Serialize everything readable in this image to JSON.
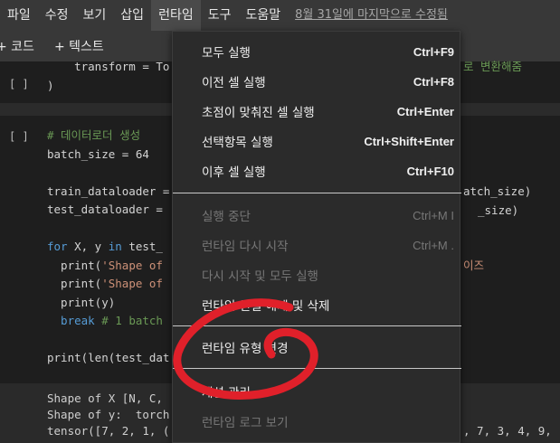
{
  "menubar": {
    "items": [
      "파일",
      "수정",
      "보기",
      "삽입",
      "런타임",
      "도구",
      "도움말"
    ],
    "last_edit": "8월 31일에 마지막으로 수정됨"
  },
  "toolbar": {
    "code": "+ 코드",
    "text": "+ 텍스트"
  },
  "cells": {
    "cell1": {
      "bracket": "[ ]",
      "line_a": "    transform = To",
      "line_a_tail": "로 변환해줌",
      "line_b": ")"
    },
    "cell2": {
      "bracket": "[ ]",
      "comment": "# 데이터로더 생성",
      "batch": "batch_size = 64",
      "train": "train_dataloader = ",
      "train_tail": "atch_size)",
      "test": "test_dataloader = ",
      "test_tail": "_size)",
      "for_kw": "for",
      "for_rest": " X, y ",
      "in_kw": "in",
      "for_rest2": " test_",
      "print1_fn": "  print(",
      "print1_str": "'Shape of ",
      "print1_tail": "이즈",
      "print2_fn": "  print(",
      "print2_str": "'Shape of ",
      "print3": "  print(y)",
      "break_kw": "  break",
      "break_cm": " # 1 batch",
      "print_len": "print(len(test_dat"
    }
  },
  "output": {
    "line1": "Shape of X [N, C, ",
    "line2": "Shape of y:  torch",
    "line3": "tensor([7, 2, 1, (",
    "line3_tail": ", 7, 3, 4, 9,"
  },
  "dropdown": {
    "items": [
      {
        "label": "모두 실행",
        "shortcut": "Ctrl+F9",
        "enabled": true
      },
      {
        "label": "이전 셀 실행",
        "shortcut": "Ctrl+F8",
        "enabled": true
      },
      {
        "label": "초점이 맞춰진 셀 실행",
        "shortcut": "Ctrl+Enter",
        "enabled": true
      },
      {
        "label": "선택항목 실행",
        "shortcut": "Ctrl+Shift+Enter",
        "enabled": true
      },
      {
        "label": "이후 셀 실행",
        "shortcut": "Ctrl+F10",
        "enabled": true
      },
      {
        "label": "실행 중단",
        "shortcut": "Ctrl+M I",
        "enabled": false
      },
      {
        "label": "런타임 다시 시작",
        "shortcut": "Ctrl+M .",
        "enabled": false
      },
      {
        "label": "다시 시작 및 모두 실행",
        "shortcut": "",
        "enabled": false
      },
      {
        "label": "런타임 연결 해제 및 삭제",
        "shortcut": "",
        "enabled": true
      },
      {
        "label": "런타임 유형 변경",
        "shortcut": "",
        "enabled": true
      },
      {
        "label": "세션 관리",
        "shortcut": "",
        "enabled": true
      },
      {
        "label": "런타임 로그 보기",
        "shortcut": "",
        "enabled": false
      }
    ]
  },
  "colors": {
    "annotation_circle": "#e0202a",
    "menubar_bg": "#383838",
    "dropdown_bg": "#2b2b2b"
  }
}
